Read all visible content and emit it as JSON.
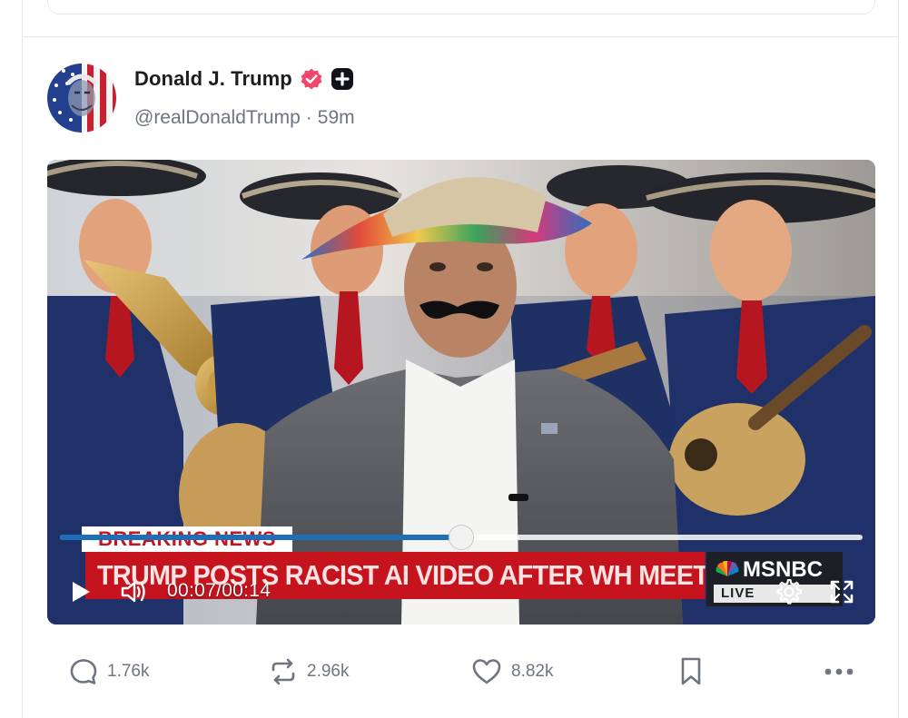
{
  "post": {
    "author": {
      "display_name": "Donald J. Trump",
      "handle": "@realDonaldTrump",
      "separator": "·",
      "timestamp": "59m",
      "verified_badge_color": "#f0476a",
      "avatar_icon": "avatar-flag-portrait"
    },
    "video": {
      "chyron": {
        "label": "BREAKING NEWS",
        "headline": "TRUMP POSTS RACIST AI VIDEO AFTER WH MEETING W/ DEMS",
        "network": "MSNBC",
        "live": "LIVE"
      },
      "player": {
        "time_current": "00:07",
        "time_separator": "/",
        "time_total": "00:14",
        "progress_fraction": 0.5,
        "play_icon": "play-icon",
        "volume_icon": "volume-icon",
        "settings_icon": "gear-icon",
        "fullscreen_icon": "fullscreen-icon",
        "progress_color": "#1d6fb8"
      }
    },
    "actions": {
      "replies": "1.76k",
      "reposts": "2.96k",
      "likes": "8.82k",
      "bookmark_icon": "bookmark-icon",
      "more_icon": "more-icon"
    }
  }
}
